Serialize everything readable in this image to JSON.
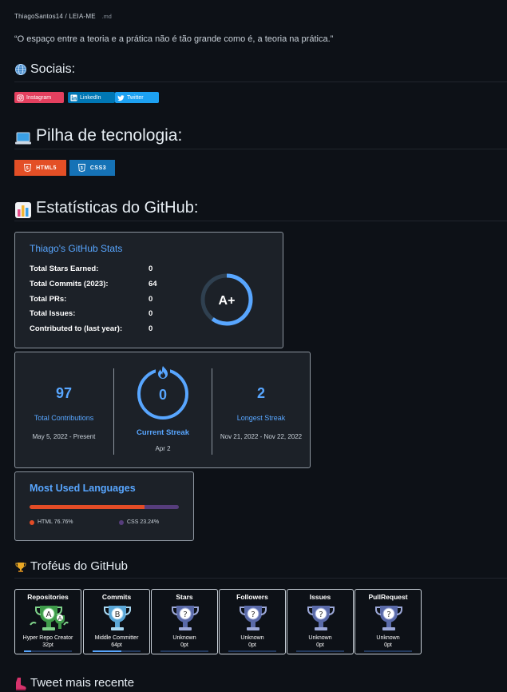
{
  "breadcrumb": {
    "path": "ThiagoSantos14 / LEIA-ME",
    "ext": ".md"
  },
  "quote": "“O espaço entre a teoria e a prática não é tão grande como é, a teoria na prática.”",
  "sections": {
    "social": "Sociais:",
    "stack": "Pilha de tecnologia:",
    "stats": "Estatísticas do GitHub:",
    "trophies": "Troféus do GitHub",
    "tweet": "Tweet mais recente"
  },
  "social_badges": [
    {
      "label": "Instagram",
      "color": "#E4405F",
      "icon": "instagram-icon"
    },
    {
      "label": "LinkedIn",
      "color": "#0077B5",
      "icon": "linkedin-icon"
    },
    {
      "label": "Twitter",
      "color": "#1DA1F2",
      "icon": "twitter-icon"
    }
  ],
  "tech_badges": [
    {
      "label": "HTML5",
      "color": "#E34F26",
      "icon": "html5-icon"
    },
    {
      "label": "CSS3",
      "color": "#1572B6",
      "icon": "css3-icon"
    }
  ],
  "stats_card": {
    "title": "Thiago's GitHub Stats",
    "rows": [
      {
        "label": "Total Stars Earned:",
        "value": "0"
      },
      {
        "label": "Total Commits (2023):",
        "value": "64"
      },
      {
        "label": "Total PRs:",
        "value": "0"
      },
      {
        "label": "Total Issues:",
        "value": "0"
      },
      {
        "label": "Contributed to (last year):",
        "value": "0"
      }
    ],
    "grade": "A+",
    "grade_progress": 0.6,
    "accent": "#58a6ff"
  },
  "streak_card": {
    "total": {
      "value": "97",
      "label": "Total Contributions",
      "range": "May 5, 2022 - Present"
    },
    "current": {
      "value": "0",
      "label": "Current Streak",
      "range": "Apr 2"
    },
    "longest": {
      "value": "2",
      "label": "Longest Streak",
      "range": "Nov 21, 2022 - Nov 22, 2022"
    }
  },
  "languages_card": {
    "title": "Most Used Languages",
    "languages": [
      {
        "name": "HTML",
        "percent": 76.76,
        "label": "HTML 76.76%",
        "color": "#e34c26"
      },
      {
        "name": "CSS",
        "percent": 23.24,
        "label": "CSS 23.24%",
        "color": "#563d7c"
      }
    ]
  },
  "trophies": [
    {
      "title": "Repositories",
      "rank": "A",
      "name": "Hyper Repo Creator",
      "points": "32pt",
      "progress": 0.15,
      "style": "green"
    },
    {
      "title": "Commits",
      "rank": "B",
      "name": "Middle Committer",
      "points": "64pt",
      "progress": 0.6,
      "style": "blue"
    },
    {
      "title": "Stars",
      "rank": "?",
      "name": "Unknown",
      "points": "0pt",
      "progress": 0,
      "style": "grey"
    },
    {
      "title": "Followers",
      "rank": "?",
      "name": "Unknown",
      "points": "0pt",
      "progress": 0,
      "style": "grey"
    },
    {
      "title": "Issues",
      "rank": "?",
      "name": "Unknown",
      "points": "0pt",
      "progress": 0,
      "style": "grey"
    },
    {
      "title": "PullRequest",
      "rank": "?",
      "name": "Unknown",
      "points": "0pt",
      "progress": 0,
      "style": "grey"
    }
  ]
}
